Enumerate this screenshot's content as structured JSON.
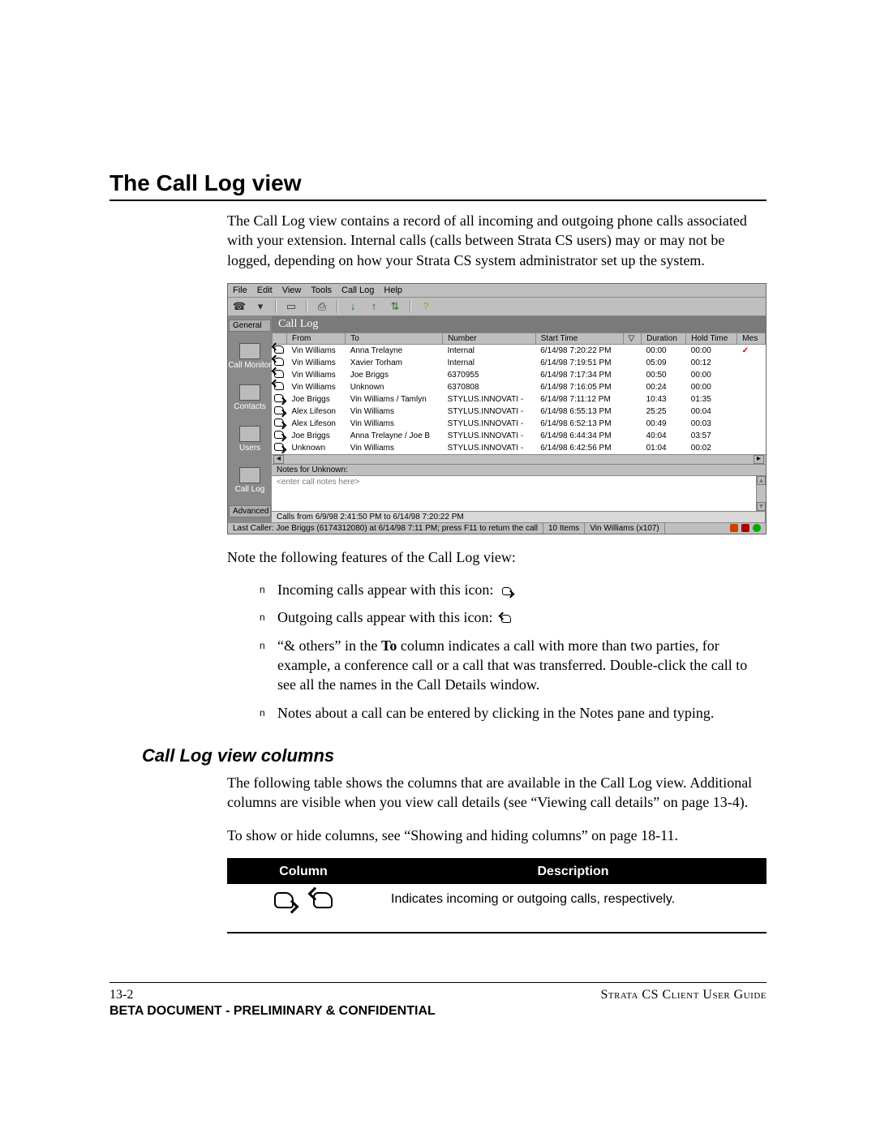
{
  "heading": "The Call Log view",
  "intro": "The Call Log view contains a record of all incoming and outgoing phone calls associated with your extension. Internal calls (calls between Strata CS users) may or may not be logged, depending on how your Strata CS system administrator set up the system.",
  "note_features": "Note the following features of the Call Log view:",
  "bullets": {
    "incoming": "Incoming calls appear with this icon:",
    "outgoing": "Outgoing calls appear with this icon:",
    "others": "“& others” in the To column indicates a call with more than two parties, for example, a conference call or a call that was transferred. Double-click the call to see all the names in the Call Details window.",
    "notes": "Notes about a call can be entered by clicking in the Notes pane and typing."
  },
  "bullets_others_bold": "To",
  "h2": "Call Log view columns",
  "columns_intro": "The following table shows the columns that are available in the Call Log view. Additional columns are visible when you view call details (see “Viewing call details” on page 13-4).",
  "show_hide": "To show or hide columns, see “Showing and hiding columns” on page 18-11.",
  "table": {
    "col1": "Column",
    "col2": "Description",
    "row1_desc": "Indicates incoming or outgoing calls, respectively."
  },
  "footer": {
    "pagenum": "13-2",
    "guide": "Strata CS Client User Guide",
    "beta": "BETA DOCUMENT - PRELIMINARY & CONFIDENTIAL"
  },
  "screenshot": {
    "menus": [
      "File",
      "Edit",
      "View",
      "Tools",
      "Call Log",
      "Help"
    ],
    "left_tabs": {
      "general": "General",
      "call_monitor": "Call Monitor",
      "contacts": "Contacts",
      "users": "Users",
      "call_log": "Call Log",
      "advanced": "Advanced"
    },
    "view_title": "Call Log",
    "headers": [
      "",
      "From",
      "To",
      "Number",
      "Start Time",
      "▽",
      "Duration",
      "Hold Time",
      "Mes"
    ],
    "rows": [
      {
        "dir": "out",
        "from": "Vin Williams",
        "to": "Anna Trelayne",
        "num": "Internal",
        "start": "6/14/98 7:20:22 PM",
        "dur": "00:00",
        "hold": "00:00",
        "mes": "✓"
      },
      {
        "dir": "out",
        "from": "Vin Williams",
        "to": "Xavier Torham",
        "num": "Internal",
        "start": "6/14/98 7:19:51 PM",
        "dur": "05:09",
        "hold": "00:12",
        "mes": ""
      },
      {
        "dir": "out",
        "from": "Vin Williams",
        "to": "Joe Briggs",
        "num": "6370955",
        "start": "6/14/98 7:17:34 PM",
        "dur": "00:50",
        "hold": "00:00",
        "mes": ""
      },
      {
        "dir": "out",
        "from": "Vin Williams",
        "to": "Unknown",
        "num": "6370808",
        "start": "6/14/98 7:16:05 PM",
        "dur": "00:24",
        "hold": "00:00",
        "mes": ""
      },
      {
        "dir": "in",
        "from": "Joe Briggs",
        "to": "Vin Williams / Tamlyn",
        "num": "STYLUS.INNOVATI -",
        "start": "6/14/98 7:11:12 PM",
        "dur": "10:43",
        "hold": "01:35",
        "mes": ""
      },
      {
        "dir": "in",
        "from": "Alex Lifeson",
        "to": "Vin Williams",
        "num": "STYLUS.INNOVATI -",
        "start": "6/14/98 6:55:13 PM",
        "dur": "25:25",
        "hold": "00:04",
        "mes": ""
      },
      {
        "dir": "in",
        "from": "Alex Lifeson",
        "to": "Vin Williams",
        "num": "STYLUS.INNOVATI -",
        "start": "6/14/98 6:52:13 PM",
        "dur": "00:49",
        "hold": "00:03",
        "mes": ""
      },
      {
        "dir": "in",
        "from": "Joe Briggs",
        "to": "Anna Trelayne / Joe B",
        "num": "STYLUS.INNOVATI -",
        "start": "6/14/98 6:44:34 PM",
        "dur": "40:04",
        "hold": "03:57",
        "mes": ""
      },
      {
        "dir": "in",
        "from": "Unknown",
        "to": "Vin Williams",
        "num": "STYLUS.INNOVATI -",
        "start": "6/14/98 6:42:56 PM",
        "dur": "01:04",
        "hold": "00:02",
        "mes": ""
      }
    ],
    "notes_header": "Notes for Unknown:",
    "notes_placeholder": "<enter call notes here>",
    "range_status": "Calls from 6/9/98 2:41:50 PM to 6/14/98 7:20:22 PM",
    "status_last": "Last Caller: Joe Briggs (6174312080) at 6/14/98 7:11 PM; press F11 to return the call",
    "status_items": "10 Items",
    "status_user": "Vin Williams (x107)"
  }
}
